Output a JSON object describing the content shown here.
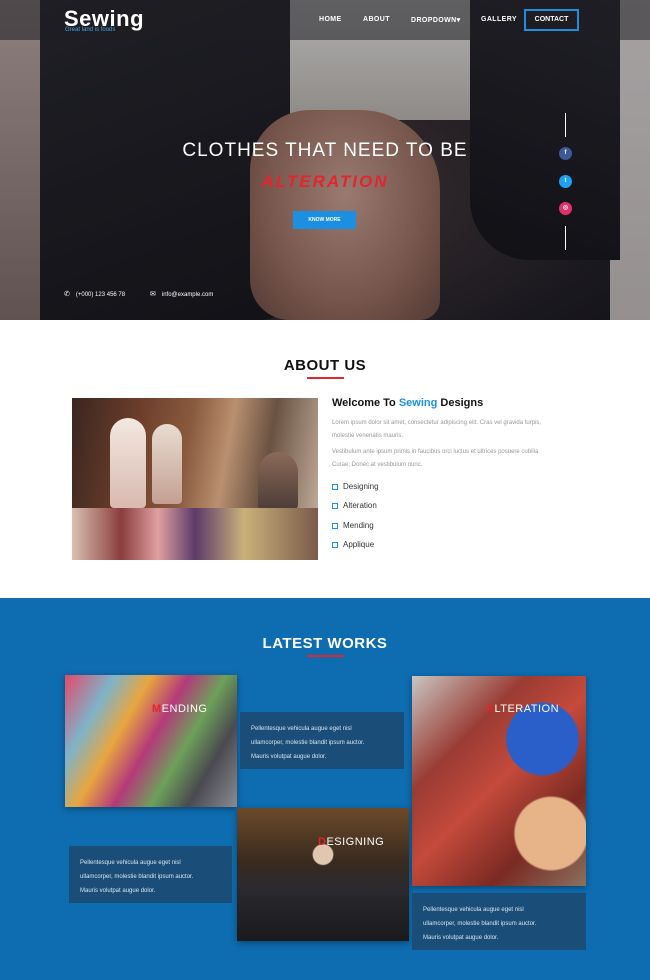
{
  "brand": {
    "logo": "Sewing",
    "tagline": "Great land is foods"
  },
  "nav": {
    "items": [
      "HOME",
      "ABOUT",
      "DROPDOWN▾",
      "GALLERY"
    ],
    "contact": "CONTACT"
  },
  "hero": {
    "title": "CLOTHES THAT NEED TO BE",
    "subtitle": "ALTERATION",
    "button": "KNOW MORE",
    "phone": "(+000) 123 456 78",
    "email": "info@example.com"
  },
  "social": {
    "facebook": "f",
    "twitter": "t",
    "instagram": "◎"
  },
  "about": {
    "title": "ABOUT US",
    "welcome_prefix": "Welcome To",
    "welcome_highlight": "Sewing",
    "welcome_suffix": "Designs",
    "para1_line1": "Lorem ipsum dolor sit amet, consectetur adipiscing elit. Cras vel gravida turpis,",
    "para1_line2": "molestie venenatis mauris.",
    "para2_line1": "Vestibulum ante ipsum primis in faucibus orci luctus et ultrices posuere cubilia",
    "para2_line2": "Curae; Donec at vestibulum nunc.",
    "services": [
      "Designing",
      "Alteration",
      "Mending",
      "Applique"
    ]
  },
  "works": {
    "title": "LATEST WORKS",
    "mending": {
      "first": "M",
      "rest": "ENDING"
    },
    "alteration": {
      "first": "A",
      "rest": "LTERATION"
    },
    "designing": {
      "first": "D",
      "rest": "ESIGNING"
    },
    "text_line1": "Pellentesque vehicula augue eget nisl",
    "text_line2": "ullamcorper, molestie blandit ipsum auctor.",
    "text_line3": "Mauris volutpat augue dolor."
  },
  "colors": {
    "accent": "#1d8fe1",
    "red": "#e3252e",
    "works_bg": "#0e6cb0",
    "text_box": "#1a4e78"
  }
}
